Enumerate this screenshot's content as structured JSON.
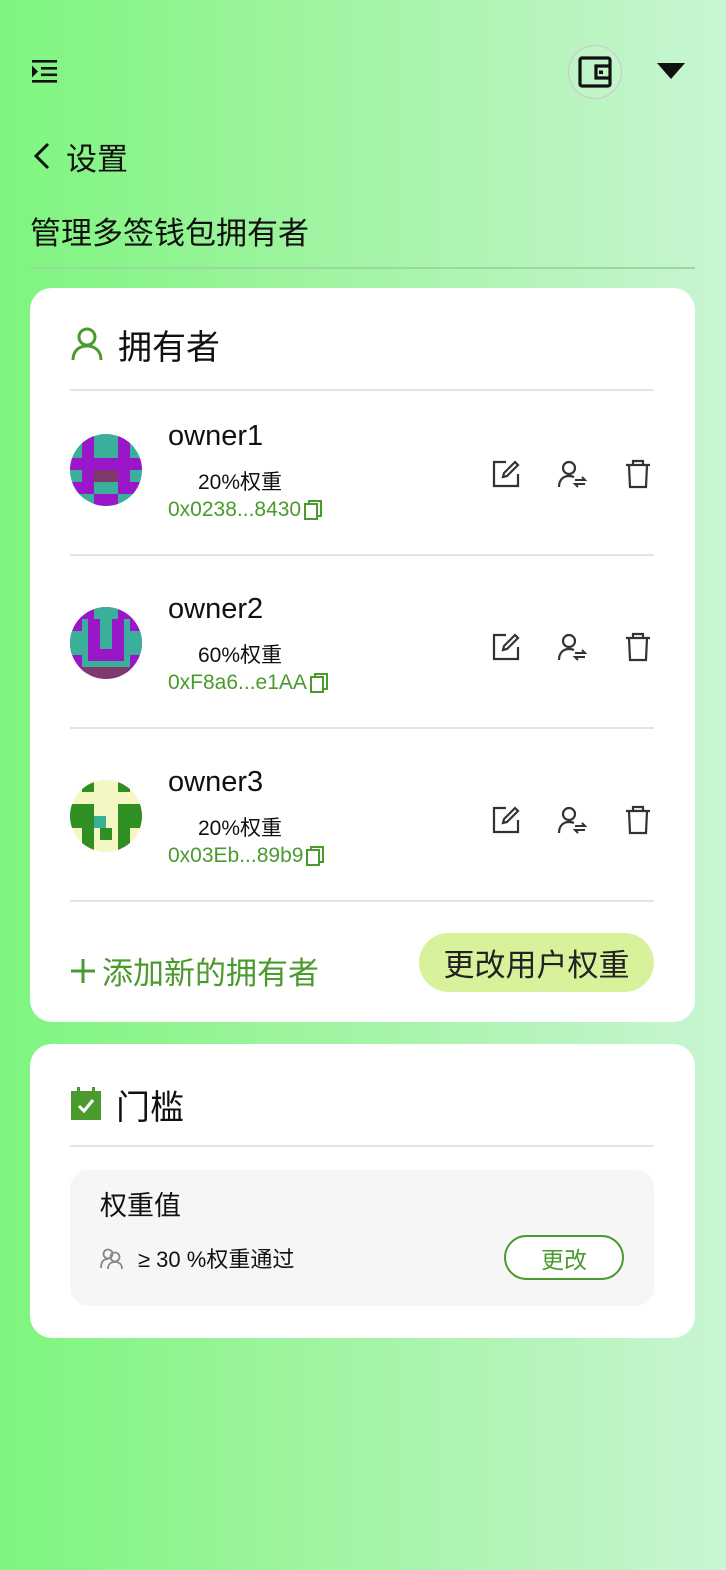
{
  "header": {
    "menu_icon": "menu-indent-icon",
    "wallet_icon": "wallet-icon",
    "dropdown_icon": "caret-down-icon"
  },
  "nav": {
    "back_label": "设置"
  },
  "page": {
    "title": "管理多签钱包拥有者"
  },
  "owners_card": {
    "title": "拥有者",
    "icon": "user-icon",
    "owners": [
      {
        "name": "owner1",
        "weight": "20%权重",
        "address": "0x0238...8430"
      },
      {
        "name": "owner2",
        "weight": "60%权重",
        "address": "0xF8a6...e1AA"
      },
      {
        "name": "owner3",
        "weight": "20%权重",
        "address": "0x03Eb...89b9"
      }
    ],
    "add_owner_label": "添加新的拥有者",
    "change_weight_label": "更改用户权重"
  },
  "threshold_card": {
    "title": "门槛",
    "icon": "checkbox-icon",
    "label": "权重值",
    "value": "≥ 30 %权重通过",
    "change_label": "更改"
  },
  "colors": {
    "accent": "#4a9a2e",
    "button_bg": "#d8f29c",
    "card_bg": "#ffffff"
  }
}
